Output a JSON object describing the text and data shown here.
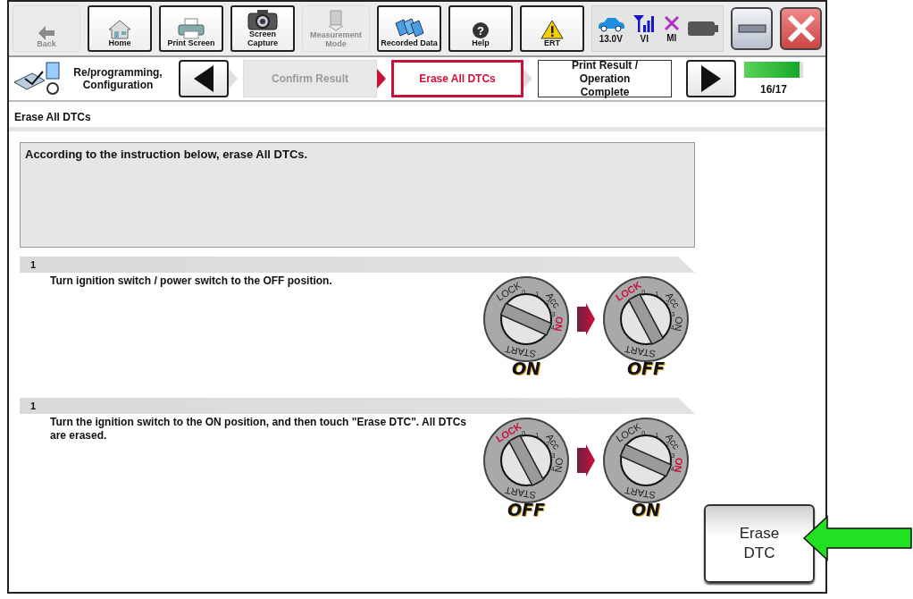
{
  "toolbar": {
    "buttons": [
      {
        "kind": "back",
        "label": "Back",
        "disabled": true
      },
      {
        "kind": "home",
        "label": "Home",
        "disabled": false
      },
      {
        "kind": "print",
        "label": "Print Screen",
        "disabled": false
      },
      {
        "kind": "camera",
        "label": "Screen Capture",
        "disabled": false
      },
      {
        "kind": "meter",
        "label": "Measurement Mode",
        "disabled": true
      },
      {
        "kind": "recorded",
        "label": "Recorded Data",
        "disabled": false
      },
      {
        "kind": "help",
        "label": "Help",
        "disabled": false,
        "glyph": "?"
      },
      {
        "kind": "ert",
        "label": "ERT",
        "disabled": false
      }
    ],
    "status": [
      {
        "kind": "car",
        "label": "13.0V"
      },
      {
        "kind": "signal",
        "label": "VI"
      },
      {
        "kind": "cross",
        "label": "MI"
      },
      {
        "kind": "battery"
      }
    ]
  },
  "stepbar": {
    "mode": "Re/programming, Configuration",
    "steps": [
      {
        "label": "Confirm Result",
        "selected": false,
        "disabled": true
      },
      {
        "label": "Erase All DTCs",
        "selected": true,
        "disabled": false
      },
      {
        "label": "Print Result / Operation Complete",
        "selected": false,
        "disabled": false
      }
    ],
    "progress": {
      "level": 0.94,
      "text": "16/17"
    }
  },
  "page_title": "Erase All DTCs",
  "instruction": "According to the instruction below, erase All DTCs.",
  "steps": [
    {
      "number": "1",
      "text": "Turn ignition switch / power switch to the OFF position.",
      "switches": [
        {
          "on": true,
          "caption": "ON",
          "labels": [
            {
              "kind": "lock",
              "text": "LOCK"
            },
            {
              "kind": "acc",
              "text": "Acc"
            },
            {
              "kind": "on",
              "text": "ON"
            },
            {
              "kind": "start",
              "text": "START"
            }
          ],
          "numbers": [
            "0",
            "1",
            "2",
            "3",
            "4"
          ]
        },
        {
          "on": false,
          "caption": "OFF",
          "labels": [
            {
              "kind": "lock",
              "text": "LOCK"
            },
            {
              "kind": "acc",
              "text": "Acc"
            },
            {
              "kind": "on",
              "text": "ON"
            },
            {
              "kind": "start",
              "text": "START"
            }
          ],
          "numbers": [
            "0",
            "1",
            "2",
            "3",
            "4"
          ]
        }
      ]
    },
    {
      "number": "1",
      "text": "Turn the ignition switch to the ON position, and then touch \"Erase DTC\". All DTCs are erased.",
      "switches": [
        {
          "on": false,
          "caption": "OFF",
          "labels": [
            {
              "kind": "lock",
              "text": "LOCK"
            },
            {
              "kind": "acc",
              "text": "Acc"
            },
            {
              "kind": "on",
              "text": "ON"
            },
            {
              "kind": "start",
              "text": "START"
            }
          ],
          "numbers": [
            "0",
            "1",
            "2",
            "3",
            "4"
          ]
        },
        {
          "on": true,
          "caption": "ON",
          "labels": [
            {
              "kind": "lock",
              "text": "LOCK"
            },
            {
              "kind": "acc",
              "text": "Acc"
            },
            {
              "kind": "on",
              "text": "ON"
            },
            {
              "kind": "start",
              "text": "START"
            }
          ],
          "numbers": [
            "0",
            "1",
            "2",
            "3",
            "4"
          ]
        }
      ]
    }
  ],
  "action_button": {
    "label": "Erase DTC",
    "highlighted": true
  }
}
